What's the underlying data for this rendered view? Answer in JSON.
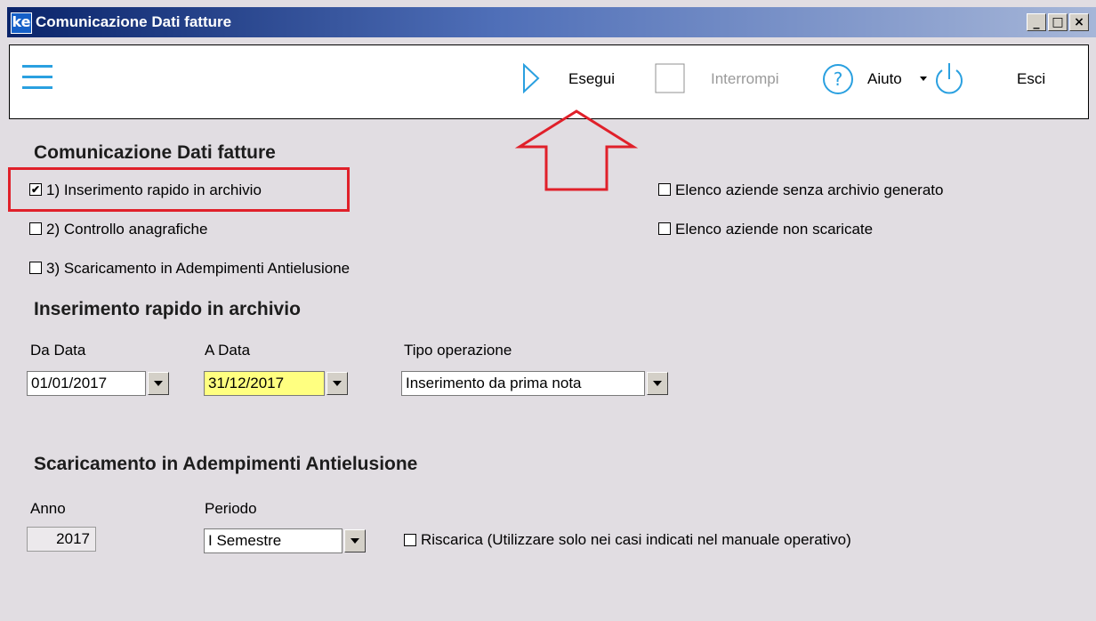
{
  "window": {
    "logo": "ke",
    "title": "Comunicazione Dati fatture",
    "minimize": "_",
    "maximize": "□",
    "close": "×"
  },
  "toolbar": {
    "run_label": "Esegui",
    "stop_label": "Interrompi",
    "help_label": "Aiuto",
    "exit_label": "Esci",
    "accent_color": "#2aa0e0"
  },
  "main": {
    "section_title": "Comunicazione Dati fatture",
    "options": [
      {
        "label": "1) Inserimento rapido in archivio",
        "checked": true
      },
      {
        "label": "2) Controllo anagrafiche",
        "checked": false
      },
      {
        "label": "3) Scaricamento in Adempimenti Antielusione",
        "checked": false
      },
      {
        "label": "Elenco aziende senza archivio generato",
        "checked": false
      },
      {
        "label": "Elenco aziende non scaricate",
        "checked": false
      }
    ]
  },
  "rapid_insert": {
    "title": "Inserimento rapido in archivio",
    "from_label": "Da Data",
    "from_value": "01/01/2017",
    "to_label": "A Data",
    "to_value": "31/12/2017",
    "op_label": "Tipo operazione",
    "op_value": "Inserimento da prima nota"
  },
  "download": {
    "title": "Scaricamento in Adempimenti Antielusione",
    "year_label": "Anno",
    "year_value": "2017",
    "period_label": "Periodo",
    "period_value": "I Semestre",
    "reload_label": "Riscarica (Utilizzare solo nei casi indicati nel manuale operativo)",
    "reload_checked": false
  },
  "colors": {
    "annotation_red": "#e0202a",
    "required_field_yellow": "#ffff80"
  }
}
